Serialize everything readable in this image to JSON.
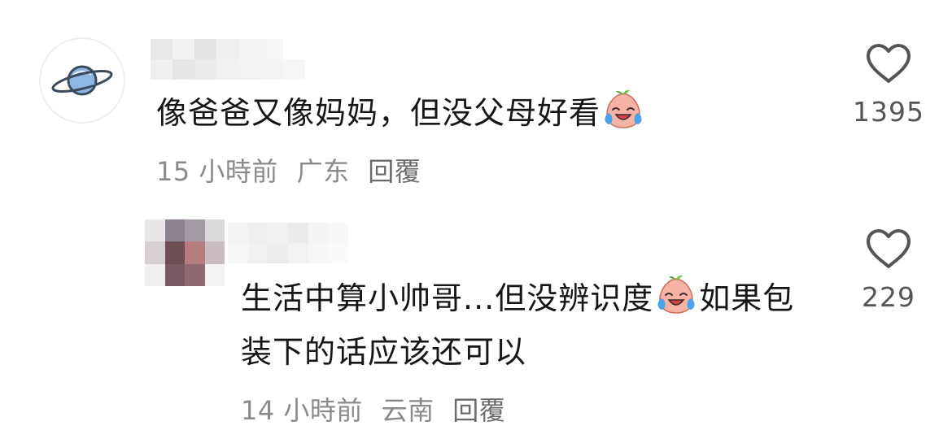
{
  "comments": [
    {
      "avatar_icon": "saturn-planet-icon",
      "text_before_emoji": "像爸爸又像妈妈，但没父母好看",
      "emoji_icon": "crying-laughing-peach-emoji",
      "text_after_emoji": "",
      "time": "15 小時前",
      "location": "广东",
      "reply_label": "回覆",
      "like_count": "1395"
    },
    {
      "avatar_icon": "blurred-avatar",
      "text_before_emoji": "生活中算小帅哥...但没辨识度",
      "emoji_icon": "crying-laughing-peach-emoji",
      "text_after_emoji": "如果包装下的话应该还可以",
      "time": "14 小時前",
      "location": "云南",
      "reply_label": "回覆",
      "like_count": "229"
    }
  ],
  "colors": {
    "text": "#161616",
    "meta": "#8a8a8a",
    "like_outline": "#555555",
    "planet_blue": "#8fb7e3"
  }
}
